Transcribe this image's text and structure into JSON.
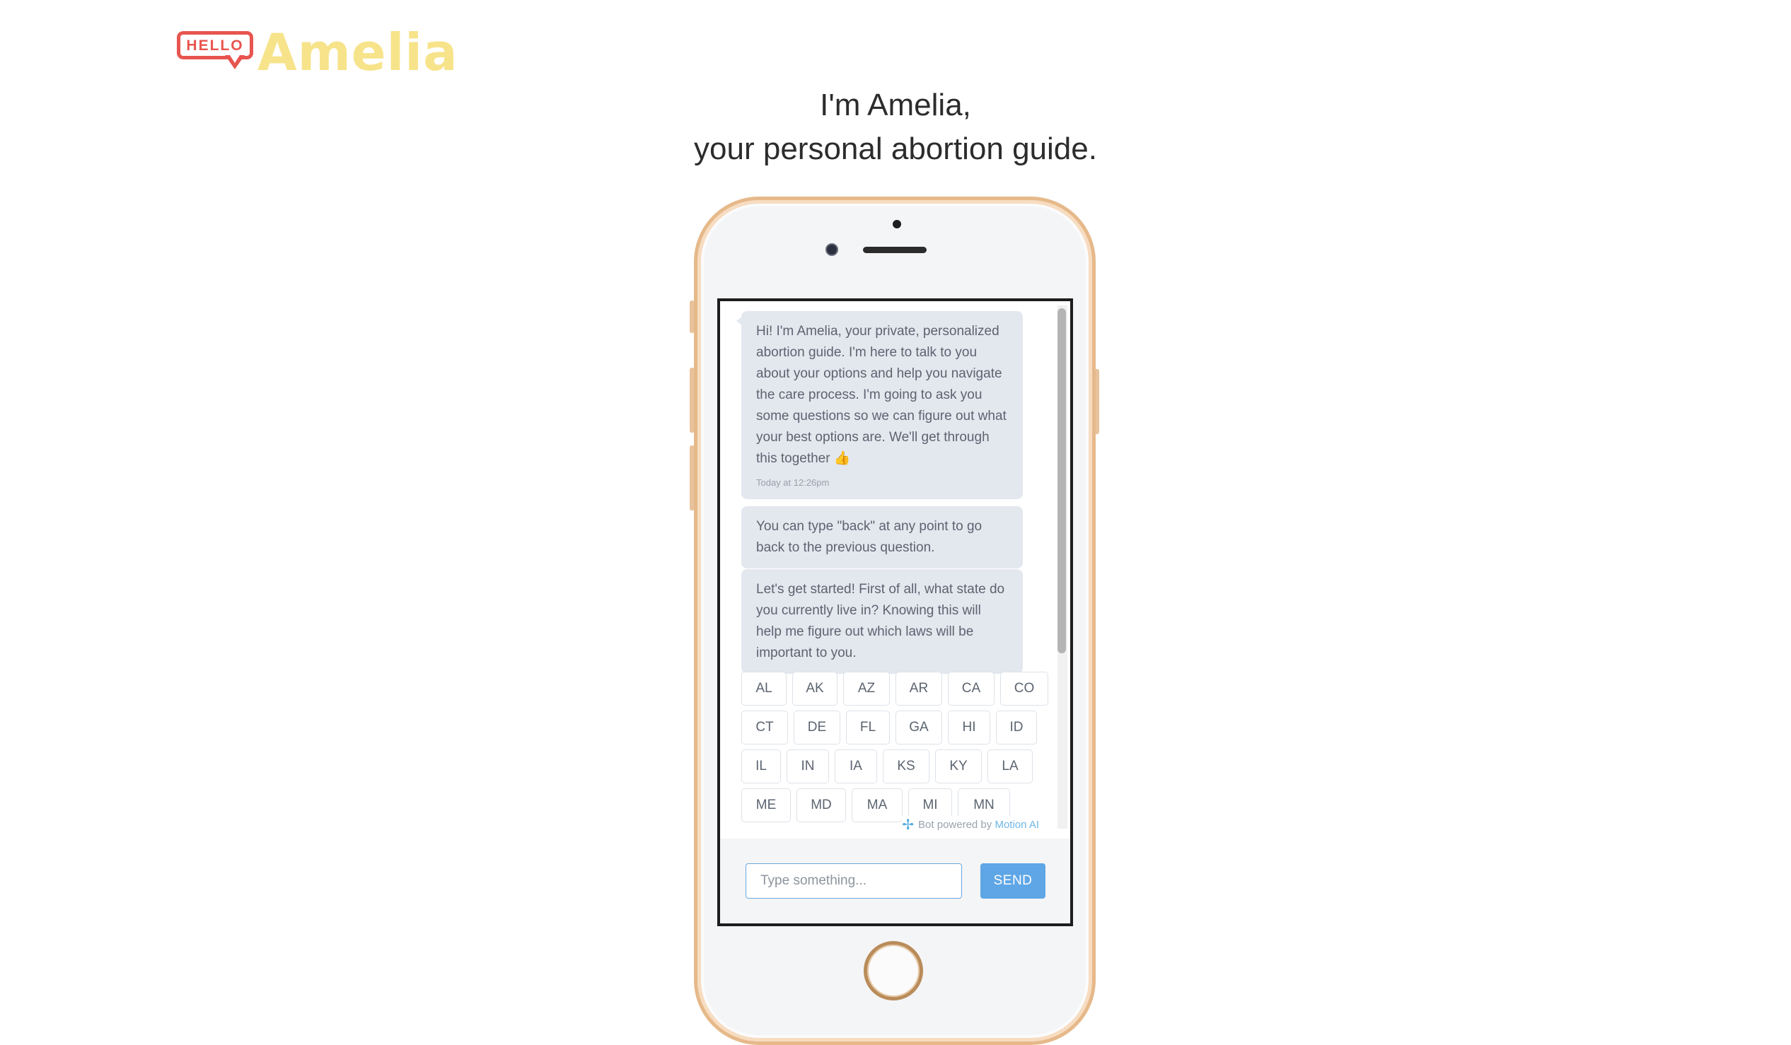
{
  "logo": {
    "hello": "HELLO",
    "name": "Amelia"
  },
  "heading": {
    "line1": "I'm Amelia,",
    "line2": "your personal abortion guide."
  },
  "chat": {
    "messages": [
      {
        "text": "Hi! I'm Amelia, your private, personalized abortion guide. I'm here to talk to you about your options and help you navigate the care process. I'm going to ask you some questions so we can figure out what your best options are. We'll get through this together 👍",
        "timestamp": "Today at 12:26pm"
      },
      {
        "text": "You can type \"back\" at any point to go back to the previous question."
      },
      {
        "text": "Let's get started! First of all, what state do you currently live in? Knowing this will help me figure out which laws will be important to you."
      }
    ],
    "state_options": [
      [
        "AL",
        "AK",
        "AZ",
        "AR",
        "CA",
        "CO"
      ],
      [
        "CT",
        "DE",
        "FL",
        "GA",
        "HI",
        "ID"
      ],
      [
        "IL",
        "IN",
        "IA",
        "KS",
        "KY",
        "LA"
      ],
      [
        "ME",
        "MD",
        "MA",
        "MI",
        "MN"
      ]
    ],
    "powered_by": {
      "prefix": "Bot powered by",
      "brand": "Motion AI"
    }
  },
  "composer": {
    "placeholder": "Type something...",
    "send_label": "SEND"
  },
  "colors": {
    "accent": "#5ea6e6",
    "logo_red": "#e8554f",
    "logo_yellow": "#f7e38a",
    "phone_gold": "#e6b98a"
  },
  "icons": {
    "bot": "motion-ai-bot-icon",
    "thumbs_up": "thumbs-up-emoji"
  }
}
